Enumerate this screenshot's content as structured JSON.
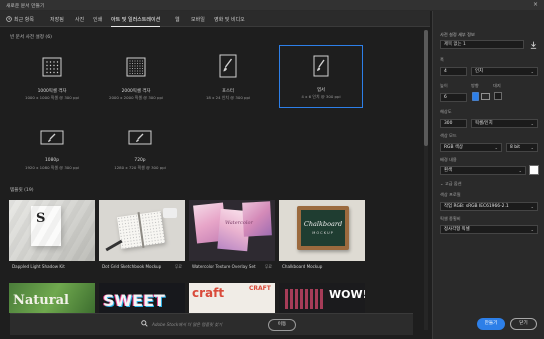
{
  "window": {
    "title": "새로운 문서 만들기",
    "close_glyph": "×"
  },
  "tabs": [
    {
      "label": "최근 항목",
      "icon": "clock-icon"
    },
    {
      "label": "저장됨"
    },
    {
      "label": "사진"
    },
    {
      "label": "인쇄"
    },
    {
      "label": "아트 및 일러스트레이션",
      "active": true
    },
    {
      "label": "웹"
    },
    {
      "label": "모바일"
    },
    {
      "label": "영화 및 비디오"
    }
  ],
  "presets_heading": "빈 문서 사전 설정 (6)",
  "presets": [
    {
      "name": "1000픽셀 격자",
      "sub": "1000 x 1000 픽셀 @ 300 ppi",
      "icon": "grid-canvas-icon"
    },
    {
      "name": "2000픽셀 격자",
      "sub": "2000 x 2000 픽셀 @ 300 ppi",
      "icon": "dense-grid-canvas-icon"
    },
    {
      "name": "포스터",
      "sub": "18 x 24 인치 @ 300 ppi",
      "icon": "paintbrush-icon"
    },
    {
      "name": "엽서",
      "sub": "4 x 6 인치 @ 300 ppi",
      "icon": "paintbrush-icon",
      "selected": true
    },
    {
      "name": "1080p",
      "sub": "1920 x 1080 픽셀 @ 300 ppi",
      "icon": "paintbrush-icon"
    },
    {
      "name": "720p",
      "sub": "1280 x 720 픽셀 @ 300 ppi",
      "icon": "paintbrush-icon"
    }
  ],
  "templates_heading": "템플릿 (19)",
  "templates": [
    {
      "name": "Dappled Light Shadow Kit",
      "badge": ""
    },
    {
      "name": "Dot Grid Sketchbook Mockup",
      "badge": "무료"
    },
    {
      "name": "Watercolor Texture Overlay Set",
      "badge": "무료"
    },
    {
      "name": "Chalkboard Mockup",
      "badge": ""
    }
  ],
  "thumb_text": {
    "chalk_line1": "Chalkboard",
    "chalk_line2": "MOCKUP",
    "natural": "Natural",
    "sweet": "SWEET",
    "craft": "craft",
    "craft_small": "CRAFT",
    "wow": "WOW!",
    "watercolor_title": "Watercolor"
  },
  "search": {
    "placeholder": "Adobe Stock에서 더 많은 템플릿 찾기",
    "go_label": "이동"
  },
  "details": {
    "section_title": "사전 설정 세부 정보",
    "doc_name": "제목 없는 1",
    "width_label": "폭",
    "width_value": "4",
    "unit_value": "인치",
    "height_label": "높이",
    "height_value": "6",
    "orientation_label": "방향",
    "artboard_label": "대지",
    "resolution_label": "해상도",
    "resolution_value": "300",
    "resolution_unit": "픽셀/인치",
    "color_mode_label": "색상 모드",
    "color_mode_value": "RGB 색상",
    "bit_depth": "8 bit",
    "background_label": "배경 내용",
    "background_value": "흰색",
    "background_swatch": "#ffffff",
    "advanced_label": "고급 옵션",
    "color_profile_label": "색상 프로필",
    "color_profile_value": "작업 RGB: sRGB IEC61966-2.1",
    "pixel_ratio_label": "픽셀 종횡비",
    "pixel_ratio_value": "정사각형 픽셀",
    "create_label": "만들기",
    "close_label": "닫기"
  },
  "colors": {
    "accent": "#2d7fe8",
    "panel": "#2a2a2a",
    "background": "#1e1e1e"
  }
}
